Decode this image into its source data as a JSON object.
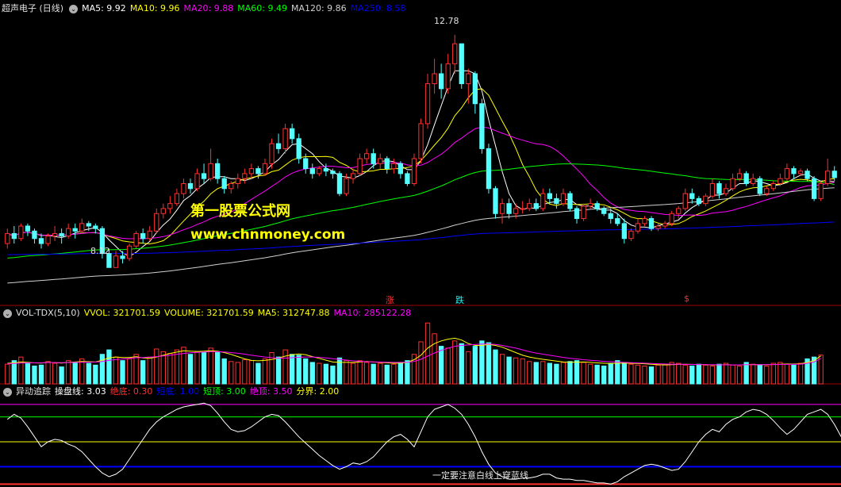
{
  "main_panel": {
    "stock_name": "超声电子 (日线)",
    "indicators": [
      {
        "text": "MA5: 9.92",
        "color": "#ffffff"
      },
      {
        "text": "MA10: 9.96",
        "color": "#ffff00"
      },
      {
        "text": "MA20: 9.88",
        "color": "#ff00ff"
      },
      {
        "text": "MA60: 9.49",
        "color": "#00ff00"
      },
      {
        "text": "MA120: 9.86",
        "color": "#d0d0d0"
      },
      {
        "text": "MA250: 8.58",
        "color": "#0000ff"
      }
    ],
    "high_label": "12.78",
    "low_label": "8.12",
    "watermark_cn": "第一股票公式网",
    "watermark_url": "www.chnmoney.com",
    "signals": [
      {
        "text": "涨",
        "color": "#ff3030"
      },
      {
        "text": "跌",
        "color": "#00ffff"
      },
      {
        "text": "$",
        "color": "#ff3030"
      }
    ]
  },
  "volume_panel": {
    "name": "VOL-TDX(5,10)",
    "indicators": [
      {
        "text": "VVOL: 321701.59",
        "color": "#ffff00"
      },
      {
        "text": "VOLUME: 321701.59",
        "color": "#ffff00"
      },
      {
        "text": "MA5: 312747.88",
        "color": "#ffff00"
      },
      {
        "text": "MA10: 285122.28",
        "color": "#ff00ff"
      }
    ]
  },
  "osc_panel": {
    "name": "异动追踪",
    "indicators": [
      {
        "text": "操盘线: 3.03",
        "color": "#ffffff"
      },
      {
        "text": "绝底: 0.30",
        "color": "#ff3030"
      },
      {
        "text": "短底: 1.00",
        "color": "#0000ff"
      },
      {
        "text": "短顶: 3.00",
        "color": "#00ff00"
      },
      {
        "text": "绝顶: 3.50",
        "color": "#ff00ff"
      },
      {
        "text": "分界: 2.00",
        "color": "#ffff00"
      }
    ],
    "note": "一定要注意白线上穿蓝线"
  },
  "chart_data": {
    "type": "candlestick",
    "price_range": [
      7.6,
      13.0
    ],
    "candles": [
      [
        8.6,
        8.8,
        8.5,
        8.9
      ],
      [
        8.8,
        8.7,
        8.6,
        8.95
      ],
      [
        8.7,
        8.95,
        8.65,
        9.0
      ],
      [
        8.95,
        8.85,
        8.75,
        9.0
      ],
      [
        8.85,
        8.7,
        8.6,
        8.9
      ],
      [
        8.7,
        8.6,
        8.5,
        8.8
      ],
      [
        8.6,
        8.75,
        8.55,
        8.8
      ],
      [
        8.75,
        8.8,
        8.65,
        8.95
      ],
      [
        8.8,
        8.75,
        8.6,
        8.9
      ],
      [
        8.75,
        8.9,
        8.7,
        9.0
      ],
      [
        8.9,
        8.85,
        8.7,
        9.0
      ],
      [
        8.85,
        9.0,
        8.8,
        9.1
      ],
      [
        9.0,
        8.95,
        8.85,
        9.05
      ],
      [
        8.95,
        8.9,
        8.8,
        9.0
      ],
      [
        8.9,
        8.4,
        8.3,
        8.95
      ],
      [
        8.4,
        8.12,
        8.12,
        8.5
      ],
      [
        8.12,
        8.35,
        8.12,
        8.45
      ],
      [
        8.35,
        8.3,
        8.2,
        8.45
      ],
      [
        8.3,
        8.55,
        8.25,
        8.6
      ],
      [
        8.55,
        8.8,
        8.5,
        8.85
      ],
      [
        8.8,
        8.7,
        8.6,
        8.9
      ],
      [
        8.7,
        8.85,
        8.65,
        8.95
      ],
      [
        8.85,
        9.2,
        8.8,
        9.3
      ],
      [
        9.2,
        9.3,
        9.1,
        9.4
      ],
      [
        9.3,
        9.4,
        9.2,
        9.55
      ],
      [
        9.4,
        9.6,
        9.35,
        9.7
      ],
      [
        9.6,
        9.8,
        9.5,
        9.9
      ],
      [
        9.8,
        9.7,
        9.6,
        9.9
      ],
      [
        9.7,
        10.0,
        9.65,
        10.1
      ],
      [
        10.0,
        9.9,
        9.8,
        10.2
      ],
      [
        9.9,
        10.2,
        9.85,
        10.5
      ],
      [
        10.2,
        9.9,
        9.8,
        10.3
      ],
      [
        9.9,
        9.7,
        9.6,
        9.95
      ],
      [
        9.7,
        9.8,
        9.6,
        9.85
      ],
      [
        9.8,
        9.9,
        9.7,
        10.0
      ],
      [
        9.9,
        10.0,
        9.8,
        10.1
      ],
      [
        10.0,
        10.1,
        9.9,
        10.2
      ],
      [
        10.1,
        10.0,
        9.9,
        10.15
      ],
      [
        10.0,
        10.2,
        9.95,
        10.3
      ],
      [
        10.2,
        10.6,
        10.1,
        10.7
      ],
      [
        10.6,
        10.5,
        10.4,
        10.8
      ],
      [
        10.5,
        10.9,
        10.4,
        11.0
      ],
      [
        10.9,
        10.7,
        10.6,
        11.0
      ],
      [
        10.7,
        10.3,
        10.2,
        10.8
      ],
      [
        10.3,
        10.1,
        10.0,
        10.4
      ],
      [
        10.1,
        10.0,
        9.9,
        10.2
      ],
      [
        10.0,
        10.1,
        9.95,
        10.15
      ],
      [
        10.1,
        10.05,
        9.95,
        10.2
      ],
      [
        10.05,
        10.0,
        9.9,
        10.1
      ],
      [
        10.0,
        9.6,
        9.55,
        10.05
      ],
      [
        9.6,
        9.9,
        9.55,
        10.0
      ],
      [
        9.9,
        10.0,
        9.8,
        10.1
      ],
      [
        10.0,
        10.3,
        9.95,
        10.4
      ],
      [
        10.3,
        10.4,
        10.2,
        10.5
      ],
      [
        10.4,
        10.2,
        10.1,
        10.5
      ],
      [
        10.2,
        10.3,
        10.1,
        10.4
      ],
      [
        10.3,
        10.1,
        10.0,
        10.35
      ],
      [
        10.1,
        10.2,
        10.0,
        10.3
      ],
      [
        10.2,
        10.0,
        9.9,
        10.25
      ],
      [
        10.0,
        9.8,
        9.75,
        10.05
      ],
      [
        9.8,
        10.3,
        9.75,
        10.4
      ],
      [
        10.3,
        11.0,
        10.2,
        11.1
      ],
      [
        11.0,
        11.8,
        10.9,
        12.0
      ],
      [
        11.8,
        12.0,
        11.6,
        12.3
      ],
      [
        12.0,
        11.7,
        11.5,
        12.2
      ],
      [
        11.7,
        12.2,
        11.6,
        12.4
      ],
      [
        12.2,
        12.6,
        12.0,
        12.78
      ],
      [
        12.6,
        11.8,
        11.7,
        12.6
      ],
      [
        11.8,
        12.0,
        11.4,
        12.1
      ],
      [
        12.0,
        11.4,
        11.2,
        12.05
      ],
      [
        11.4,
        10.5,
        10.4,
        11.5
      ],
      [
        10.5,
        9.7,
        9.6,
        10.6
      ],
      [
        9.7,
        9.2,
        9.1,
        9.75
      ],
      [
        9.2,
        9.4,
        9.0,
        9.5
      ],
      [
        9.4,
        9.2,
        9.1,
        9.5
      ],
      [
        9.2,
        9.3,
        9.1,
        9.4
      ],
      [
        9.3,
        9.3,
        9.2,
        9.45
      ],
      [
        9.3,
        9.4,
        9.25,
        9.5
      ],
      [
        9.4,
        9.3,
        9.25,
        9.5
      ],
      [
        9.3,
        9.6,
        9.25,
        9.7
      ],
      [
        9.6,
        9.5,
        9.4,
        9.7
      ],
      [
        9.5,
        9.4,
        9.3,
        9.6
      ],
      [
        9.4,
        9.6,
        9.35,
        9.7
      ],
      [
        9.6,
        9.3,
        9.25,
        9.65
      ],
      [
        9.3,
        9.1,
        9.0,
        9.35
      ],
      [
        9.1,
        9.35,
        9.05,
        9.4
      ],
      [
        9.35,
        9.4,
        9.3,
        9.5
      ],
      [
        9.4,
        9.3,
        9.25,
        9.45
      ],
      [
        9.3,
        9.2,
        9.15,
        9.35
      ],
      [
        9.2,
        9.1,
        9.0,
        9.3
      ],
      [
        9.1,
        9.0,
        8.95,
        9.2
      ],
      [
        9.0,
        8.7,
        8.6,
        9.1
      ],
      [
        8.7,
        8.85,
        8.65,
        8.9
      ],
      [
        8.85,
        9.0,
        8.8,
        9.1
      ],
      [
        9.0,
        9.1,
        8.95,
        9.15
      ],
      [
        9.1,
        8.9,
        8.85,
        9.15
      ],
      [
        8.9,
        8.95,
        8.85,
        9.0
      ],
      [
        8.95,
        9.0,
        8.9,
        9.05
      ],
      [
        9.0,
        9.2,
        8.95,
        9.25
      ],
      [
        9.2,
        9.3,
        9.1,
        9.35
      ],
      [
        9.3,
        9.6,
        9.25,
        9.7
      ],
      [
        9.6,
        9.5,
        9.4,
        9.7
      ],
      [
        9.5,
        9.4,
        9.35,
        9.55
      ],
      [
        9.4,
        9.55,
        9.35,
        9.6
      ],
      [
        9.55,
        9.8,
        9.5,
        9.9
      ],
      [
        9.8,
        9.6,
        9.5,
        9.85
      ],
      [
        9.6,
        9.7,
        9.55,
        9.8
      ],
      [
        9.7,
        9.9,
        9.65,
        10.0
      ],
      [
        9.9,
        10.0,
        9.85,
        10.1
      ],
      [
        10.0,
        9.8,
        9.75,
        10.05
      ],
      [
        9.8,
        9.9,
        9.75,
        10.0
      ],
      [
        9.9,
        9.6,
        9.55,
        9.95
      ],
      [
        9.6,
        9.7,
        9.55,
        9.75
      ],
      [
        9.7,
        9.8,
        9.65,
        9.85
      ],
      [
        9.8,
        9.9,
        9.75,
        10.0
      ],
      [
        9.9,
        10.1,
        9.85,
        10.2
      ],
      [
        10.1,
        10.0,
        9.9,
        10.15
      ],
      [
        10.0,
        10.05,
        9.95,
        10.1
      ],
      [
        10.05,
        9.9,
        9.85,
        10.1
      ],
      [
        9.9,
        9.5,
        9.45,
        9.95
      ],
      [
        9.5,
        9.8,
        9.45,
        9.85
      ],
      [
        9.8,
        10.05,
        9.75,
        10.3
      ],
      [
        10.05,
        9.92,
        9.85,
        10.15
      ]
    ],
    "volume_range": [
      0,
      700000
    ],
    "volume": [
      220000,
      260000,
      300000,
      240000,
      200000,
      210000,
      250000,
      230000,
      190000,
      260000,
      240000,
      280000,
      230000,
      210000,
      330000,
      380000,
      300000,
      260000,
      280000,
      330000,
      260000,
      300000,
      390000,
      360000,
      340000,
      380000,
      410000,
      330000,
      360000,
      350000,
      400000,
      350000,
      280000,
      250000,
      240000,
      270000,
      260000,
      230000,
      280000,
      350000,
      300000,
      380000,
      330000,
      320000,
      280000,
      240000,
      230000,
      220000,
      200000,
      290000,
      260000,
      230000,
      260000,
      240000,
      220000,
      230000,
      210000,
      220000,
      240000,
      260000,
      330000,
      470000,
      680000,
      560000,
      420000,
      400000,
      480000,
      450000,
      360000,
      420000,
      480000,
      460000,
      380000,
      330000,
      300000,
      290000,
      280000,
      250000,
      240000,
      250000,
      230000,
      220000,
      240000,
      250000,
      260000,
      240000,
      220000,
      210000,
      200000,
      230000,
      260000,
      240000,
      220000,
      210000,
      200000,
      190000,
      210000,
      220000,
      240000,
      230000,
      210000,
      200000,
      220000,
      210000,
      200000,
      220000,
      230000,
      210000,
      200000,
      240000,
      220000,
      210000,
      200000,
      230000,
      240000,
      220000,
      210000,
      230000,
      280000,
      300000,
      322000
    ],
    "vol_ma5": [
      230000,
      235000,
      245000,
      240000,
      235000,
      232000,
      240000,
      238000,
      232000,
      240000,
      245000,
      250000,
      248000,
      245000,
      265000,
      290000,
      300000,
      295000,
      295000,
      305000,
      290000,
      286000,
      300000,
      320000,
      340000,
      355000,
      370000,
      365000,
      362000,
      365000,
      370000,
      365000,
      350000,
      330000,
      305000,
      280000,
      262000,
      258000,
      262000,
      272000,
      290000,
      310000,
      325000,
      335000,
      325000,
      305000,
      285000,
      265000,
      245000,
      240000,
      240000,
      240000,
      245000,
      250000,
      245000,
      240000,
      236000,
      230000,
      232000,
      240000,
      270000,
      320000,
      400000,
      450000,
      480000,
      500000,
      510000,
      490000,
      450000,
      430000,
      430000,
      440000,
      430000,
      410000,
      380000,
      350000,
      320000,
      300000,
      285000,
      275000,
      265000,
      255000,
      245000,
      242000,
      243000,
      245000,
      240000,
      235000,
      230000,
      228000,
      230000,
      232000,
      230000,
      228000,
      225000,
      220000,
      215000,
      212000,
      215000,
      218000,
      220000,
      218000,
      216000,
      214000,
      212000,
      212000,
      214000,
      213000,
      212000,
      214000,
      216000,
      215000,
      214000,
      216000,
      220000,
      222000,
      222000,
      225000,
      240000,
      260000,
      312748
    ],
    "vol_ma10": [
      225000,
      228000,
      232000,
      235000,
      236000,
      236000,
      238000,
      238000,
      237000,
      238000,
      240000,
      242000,
      243000,
      244000,
      250000,
      262000,
      272000,
      278000,
      284000,
      292000,
      295000,
      298000,
      305000,
      312000,
      320000,
      330000,
      340000,
      348000,
      352000,
      356000,
      360000,
      360000,
      356000,
      350000,
      342000,
      332000,
      320000,
      310000,
      300000,
      292000,
      288000,
      288000,
      292000,
      298000,
      300000,
      300000,
      296000,
      290000,
      282000,
      274000,
      266000,
      258000,
      252000,
      248000,
      246000,
      244000,
      242000,
      240000,
      240000,
      242000,
      252000,
      275000,
      310000,
      345000,
      375000,
      400000,
      420000,
      430000,
      435000,
      440000,
      445000,
      445000,
      440000,
      430000,
      415000,
      400000,
      380000,
      360000,
      345000,
      332000,
      320000,
      308000,
      296000,
      286000,
      278000,
      270000,
      264000,
      258000,
      252000,
      248000,
      244000,
      240000,
      237000,
      234000,
      231000,
      228000,
      225000,
      222000,
      220000,
      219000,
      218000,
      217000,
      216000,
      215000,
      214000,
      213000,
      213000,
      213000,
      213000,
      214000,
      215000,
      215000,
      215000,
      216000,
      217000,
      218000,
      219000,
      221000,
      230000,
      245000,
      285122
    ],
    "osc_range": [
      0.25,
      3.75
    ],
    "osc_line": [
      2.9,
      3.1,
      2.95,
      2.6,
      2.2,
      1.8,
      2.0,
      2.1,
      2.05,
      1.9,
      1.8,
      1.6,
      1.3,
      1.0,
      0.75,
      0.6,
      0.7,
      0.9,
      1.3,
      1.7,
      2.1,
      2.5,
      2.8,
      3.0,
      3.15,
      3.3,
      3.4,
      3.45,
      3.5,
      3.55,
      3.45,
      3.15,
      2.8,
      2.5,
      2.4,
      2.45,
      2.6,
      2.8,
      3.0,
      3.1,
      3.05,
      2.8,
      2.5,
      2.2,
      1.95,
      1.7,
      1.45,
      1.25,
      1.05,
      0.9,
      1.0,
      1.15,
      1.1,
      1.2,
      1.4,
      1.7,
      2.0,
      2.2,
      2.3,
      2.1,
      1.8,
      2.4,
      3.0,
      3.3,
      3.4,
      3.5,
      3.35,
      3.1,
      2.7,
      2.2,
      1.6,
      1.1,
      0.75,
      0.6,
      0.5,
      0.5,
      0.55,
      0.55,
      0.6,
      0.7,
      0.7,
      0.55,
      0.5,
      0.5,
      0.45,
      0.45,
      0.4,
      0.35,
      0.35,
      0.3,
      0.4,
      0.6,
      0.75,
      0.9,
      1.05,
      1.1,
      1.05,
      0.95,
      0.85,
      0.9,
      1.2,
      1.6,
      2.0,
      2.3,
      2.5,
      2.4,
      2.7,
      2.9,
      3.0,
      3.2,
      3.3,
      3.25,
      3.1,
      2.85,
      2.55,
      2.3,
      2.5,
      2.8,
      3.1,
      3.2,
      3.3,
      3.1,
      2.7,
      2.2,
      1.7,
      1.3,
      1.1,
      1.4,
      2.2,
      2.6,
      3.03
    ],
    "levels": [
      {
        "name": "绝底",
        "value": 0.3,
        "color": "#ff3030"
      },
      {
        "name": "短底",
        "value": 1.0,
        "color": "#0000ff"
      },
      {
        "name": "短顶",
        "value": 3.0,
        "color": "#00ff00"
      },
      {
        "name": "绝顶",
        "value": 3.5,
        "color": "#ff00ff"
      },
      {
        "name": "分界",
        "value": 2.0,
        "color": "#ffff00"
      }
    ]
  }
}
